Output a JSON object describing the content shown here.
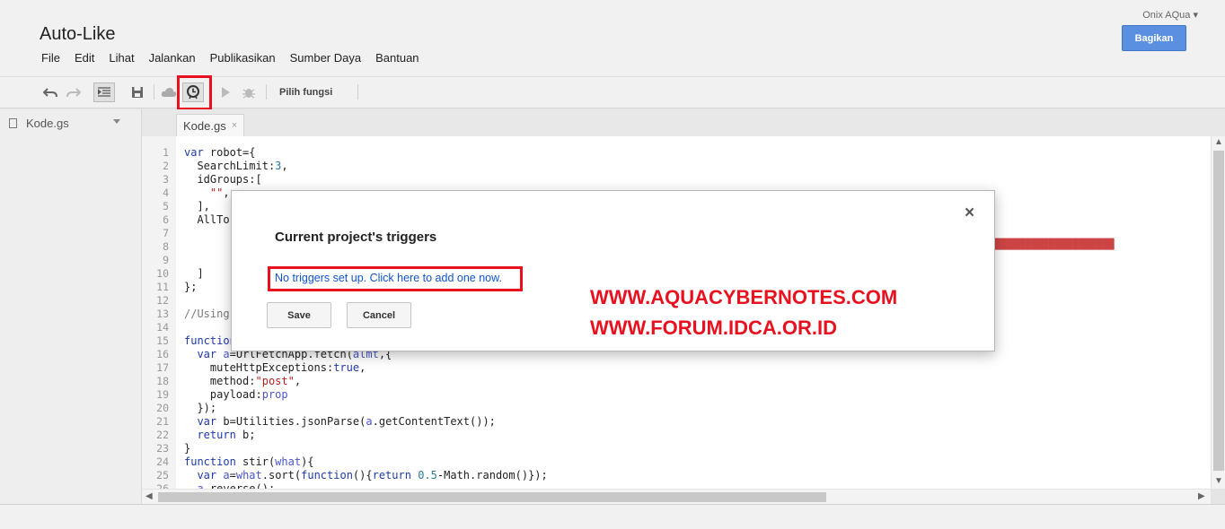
{
  "header": {
    "app_title": "Auto-Like",
    "user": "Onix AQua",
    "share_label": "Bagikan",
    "menu": [
      "File",
      "Edit",
      "Lihat",
      "Jalankan",
      "Publikasikan",
      "Sumber Daya",
      "Bantuan"
    ]
  },
  "toolbar": {
    "select_function_label": "Pilih fungsi",
    "icons": [
      "undo-icon",
      "redo-icon",
      "indent-icon",
      "save-icon",
      "deploy-cloud-icon",
      "trigger-clock-icon",
      "run-icon",
      "debug-icon"
    ]
  },
  "sidebar": {
    "file_name": "Kode.gs"
  },
  "tab": {
    "label": "Kode.gs",
    "close": "×"
  },
  "code_lines": [
    "var robot={",
    "  SearchLimit:3,",
    "  idGroups:[",
    "    \"\",",
    "  ],",
    "  AllTo",
    "",
    "",
    "",
    "  ]",
    "};",
    "",
    "//Using",
    "",
    "function",
    "  var a=UrlFetchApp.fetch(almt,{",
    "    muteHttpExceptions:true,",
    "    method:\"post\",",
    "    payload:prop",
    "  });",
    "  var b=Utilities.jsonParse(a.getContentText());",
    "  return b;",
    "}",
    "function stir(what){",
    "  var a=what.sort(function(){return 0.5-Math.random()});",
    "  a.reverse();"
  ],
  "dialog": {
    "title": "Current project's triggers",
    "link": "No triggers set up. Click here to add one now.",
    "save": "Save",
    "cancel": "Cancel",
    "close": "×"
  },
  "watermark": {
    "line1": "WWW.AQUACYBERNOTES.COM",
    "line2": "WWW.FORUM.IDCA.OR.ID"
  },
  "colors": {
    "highlight": "#e8111f",
    "share_button": "#5b8fe0",
    "link": "#1155cc"
  }
}
